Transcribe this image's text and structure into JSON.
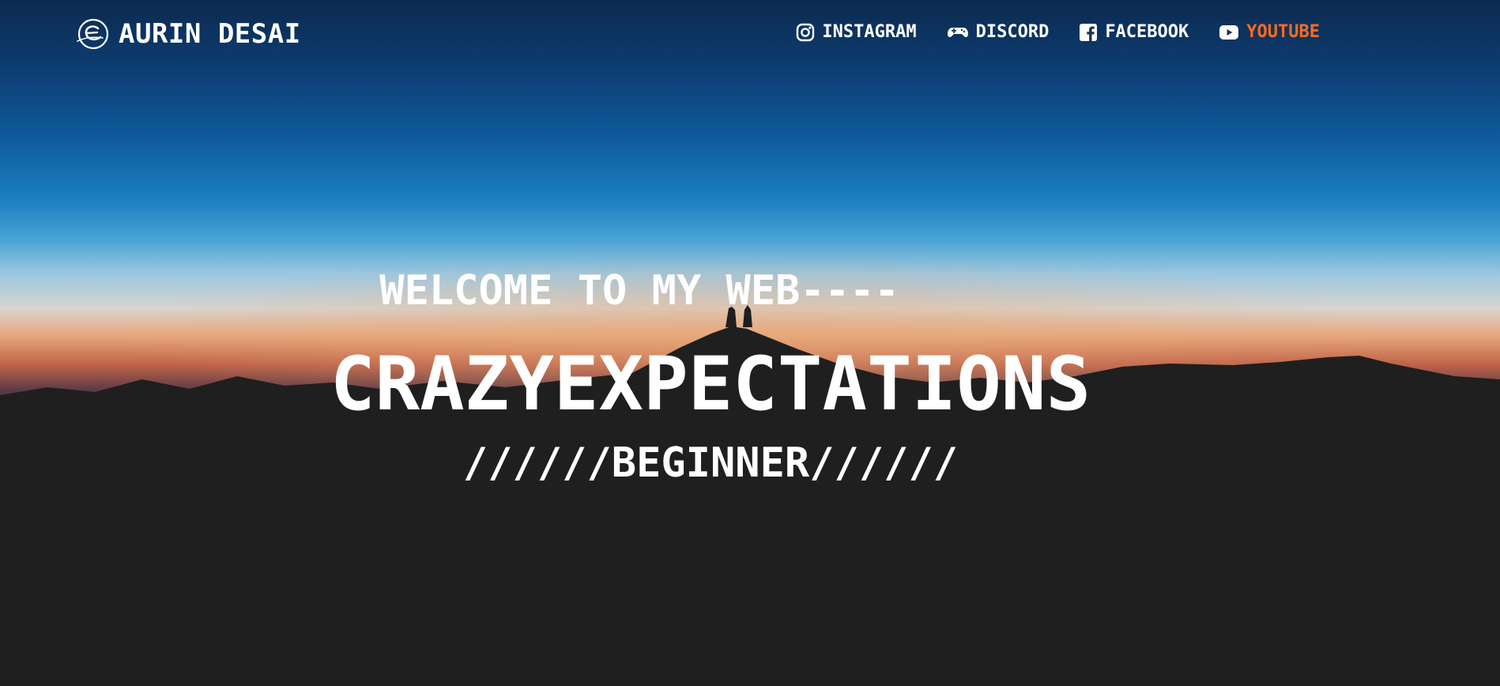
{
  "brand": {
    "name": "AURIN DESAI",
    "logo_icon": "script-e-logo-icon"
  },
  "nav": {
    "items": [
      {
        "label": "INSTAGRAM",
        "icon": "instagram-icon"
      },
      {
        "label": "DISCORD",
        "icon": "gamepad-icon"
      },
      {
        "label": "FACEBOOK",
        "icon": "facebook-icon"
      },
      {
        "label": "YOUTUBE",
        "icon": "youtube-icon",
        "active": true
      }
    ]
  },
  "hero": {
    "welcome": "WELCOME TO MY WEB----",
    "title": "CRAZYEXPECTATIONS",
    "tagline": "//////BEGINNER//////"
  },
  "colors": {
    "accent": "#ff6a1f",
    "text": "#ffffff",
    "ground": "#1f1f1f"
  }
}
